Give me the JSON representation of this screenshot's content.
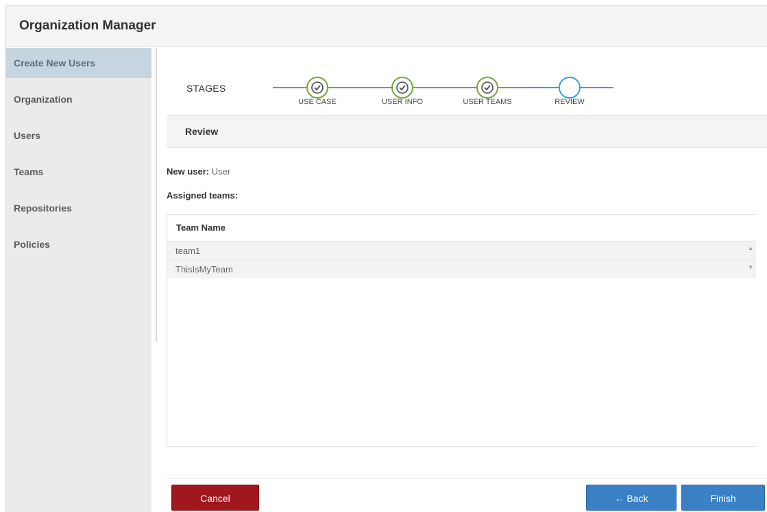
{
  "app": {
    "title": "Organization Manager"
  },
  "sidebar": {
    "items": [
      {
        "label": "Create New Users",
        "active": true
      },
      {
        "label": "Organization"
      },
      {
        "label": "Users"
      },
      {
        "label": "Teams"
      },
      {
        "label": "Repositories"
      },
      {
        "label": "Policies"
      }
    ]
  },
  "stages": {
    "label": "STAGES",
    "steps": [
      {
        "label": "USE CASE",
        "status": "complete"
      },
      {
        "label": "USER INFO",
        "status": "complete"
      },
      {
        "label": "USER TEAMS",
        "status": "complete"
      },
      {
        "label": "REVIEW",
        "status": "current"
      }
    ],
    "colors": {
      "complete": "#77a63a",
      "current": "#3b9fd8"
    }
  },
  "review": {
    "heading": "Review",
    "new_user_label": "New user:",
    "new_user_value": "User",
    "assigned_teams_label": "Assigned teams:"
  },
  "teams_table": {
    "header": "Team Name",
    "rows": [
      "team1",
      "ThisIsMyTeam"
    ]
  },
  "buttons": {
    "cancel": "Cancel",
    "back": "← Back",
    "finish": "Finish"
  },
  "colors": {
    "cancel": "#a1171e",
    "primary": "#3a80c4",
    "sidebar_active": "#c6d5df"
  }
}
